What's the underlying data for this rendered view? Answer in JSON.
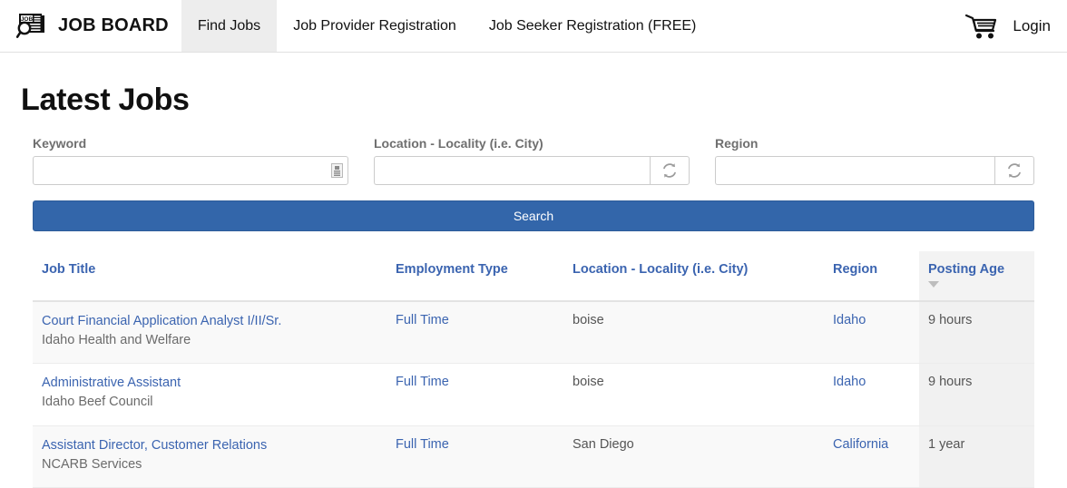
{
  "navbar": {
    "logo_icon": "job-board-logo-icon",
    "brand": "JOB BOARD",
    "links": [
      {
        "label": "Find Jobs",
        "active": true
      },
      {
        "label": "Job Provider Registration",
        "active": false
      },
      {
        "label": "Job Seeker Registration (FREE)",
        "active": false
      }
    ],
    "cart_icon": "shopping-cart-icon",
    "login_label": "Login"
  },
  "page": {
    "title": "Latest Jobs"
  },
  "search": {
    "keyword": {
      "label": "Keyword",
      "value": "",
      "placeholder": "",
      "grip_icon": "resize-grip-icon"
    },
    "location": {
      "label": "Location - Locality (i.e. City)",
      "value": "",
      "placeholder": "",
      "refresh_icon": "refresh-icon"
    },
    "region": {
      "label": "Region",
      "value": "",
      "placeholder": "",
      "refresh_icon": "refresh-icon"
    },
    "search_button": "Search",
    "accent_color": "#3366aa"
  },
  "table": {
    "headers": [
      {
        "label": "Job Title",
        "link": true,
        "sorted": false
      },
      {
        "label": "Employment Type",
        "link": true,
        "sorted": false
      },
      {
        "label": "Location - Locality (i.e. City)",
        "link": true,
        "sorted": false
      },
      {
        "label": "Region",
        "link": false,
        "sorted": false
      },
      {
        "label": "Posting Age",
        "link": true,
        "sorted": true,
        "sort_direction": "desc"
      }
    ],
    "rows": [
      {
        "title": "Court Financial Application Analyst I/II/Sr.",
        "company": "Idaho Health and Welfare",
        "employment_type": "Full Time",
        "location": "boise",
        "region": "Idaho",
        "posting_age": "9 hours"
      },
      {
        "title": "Administrative Assistant",
        "company": "Idaho Beef Council",
        "employment_type": "Full Time",
        "location": "boise",
        "region": "Idaho",
        "posting_age": "9 hours"
      },
      {
        "title": "Assistant Director, Customer Relations",
        "company": "NCARB Services",
        "employment_type": "Full Time",
        "location": "San Diego",
        "region": "California",
        "posting_age": "1 year"
      }
    ]
  }
}
